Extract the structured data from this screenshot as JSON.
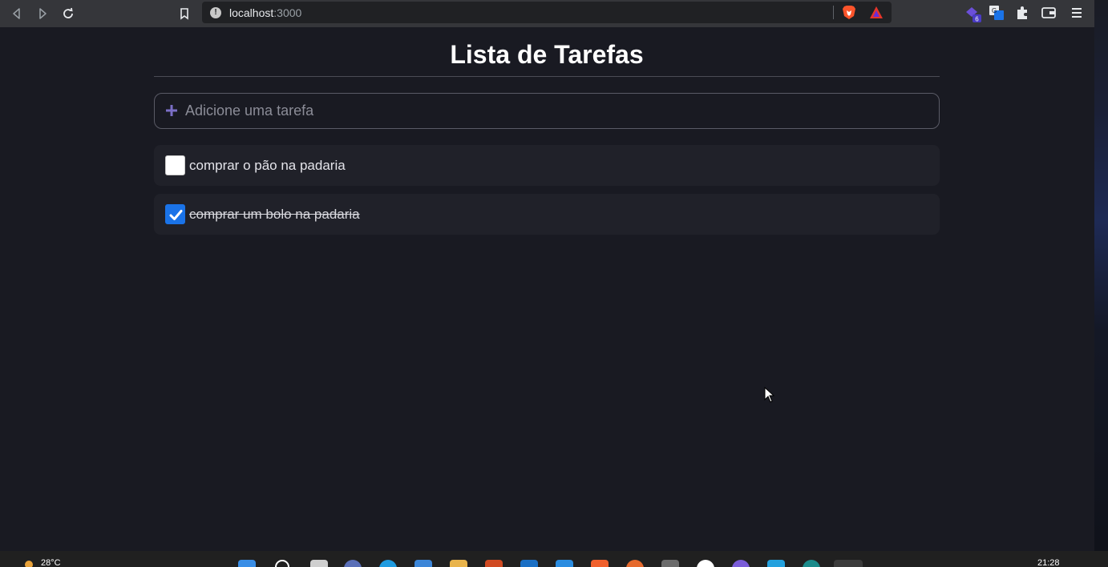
{
  "browser": {
    "url_host": "localhost",
    "url_port": ":3000",
    "extension_badge": "6"
  },
  "app": {
    "title": "Lista de Tarefas",
    "add_placeholder": "Adicione uma tarefa",
    "tasks": [
      {
        "text": "comprar o pão na padaria",
        "completed": false
      },
      {
        "text": "comprar um bolo na padaria",
        "completed": true
      }
    ]
  },
  "taskbar": {
    "temperature": "28°C",
    "time": "21:28"
  },
  "colors": {
    "background": "#191a22",
    "task_background": "#202129",
    "accent_plus": "#7b6fc7",
    "checkbox_checked": "#1a73e8"
  }
}
